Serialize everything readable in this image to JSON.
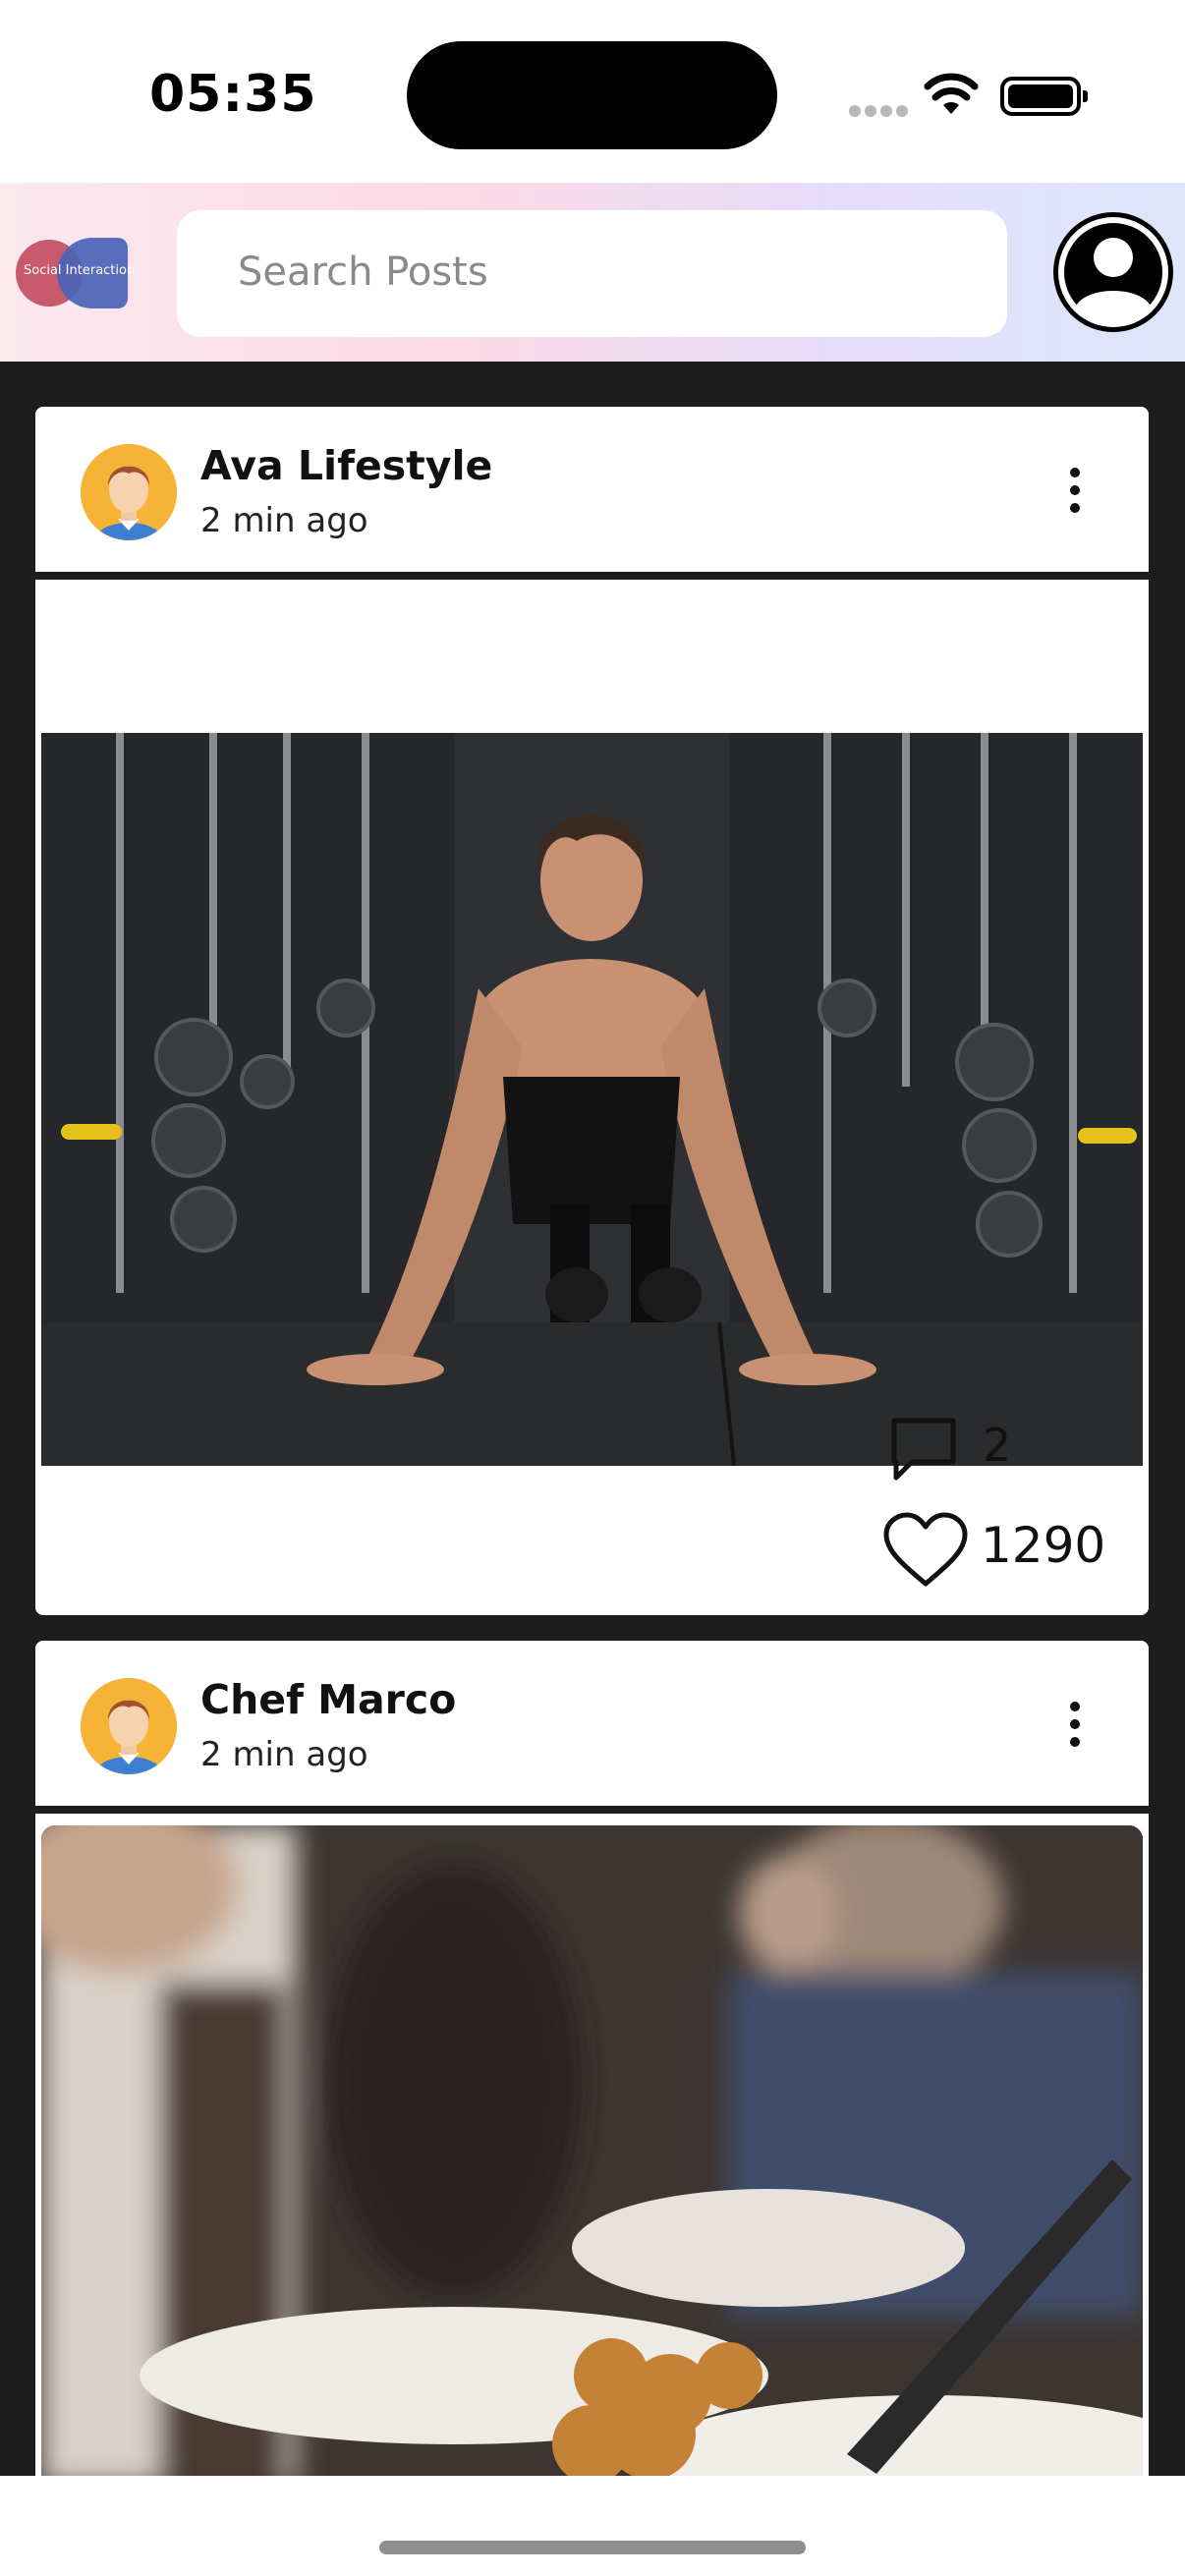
{
  "status_bar": {
    "time": "05:35"
  },
  "header": {
    "logo_text": "Social Interaction",
    "search_placeholder": "Search Posts"
  },
  "posts": [
    {
      "author": "Ava Lifestyle",
      "time": "2 min ago",
      "image": "man-doing-pushups-in-gym",
      "comments": "2",
      "likes": "1290"
    },
    {
      "author": "Chef Marco",
      "time": "2 min ago",
      "image": "restaurant-food-plates-blurred-diners"
    }
  ],
  "colors": {
    "background": "#1d1d1d",
    "header_gradient_start": "#fde8ee",
    "header_gradient_end": "#dde6fb",
    "avatar_bg": "#f7b335"
  }
}
